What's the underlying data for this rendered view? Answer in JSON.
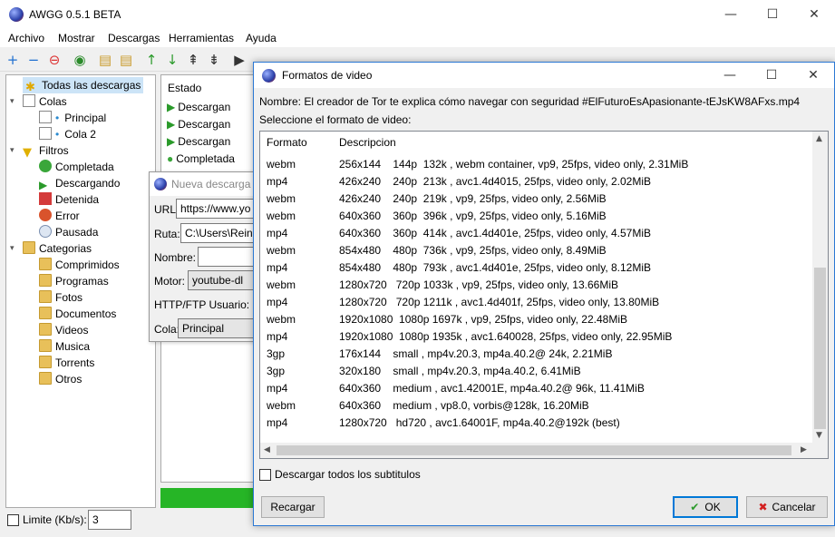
{
  "main_window": {
    "title": "AWGG 0.5.1 BETA",
    "menu": [
      "Archivo",
      "Mostrar",
      "Descargas",
      "Herramientas",
      "Ayuda"
    ]
  },
  "sidebar": {
    "all": "Todas las descargas",
    "colas": "Colas",
    "principal": "Principal",
    "cola2": "Cola 2",
    "filtros": "Filtros",
    "completada": "Completada",
    "descargando": "Descargando",
    "detenida": "Detenida",
    "error": "Error",
    "pausada": "Pausada",
    "categorias": "Categorias",
    "comprimidos": "Comprimidos",
    "programas": "Programas",
    "fotos": "Fotos",
    "documentos": "Documentos",
    "videos": "Videos",
    "musica": "Musica",
    "torrents": "Torrents",
    "otros": "Otros"
  },
  "download_list": {
    "header": "Estado",
    "rows": [
      "Descargan",
      "Descargan",
      "Descargan",
      "Completada"
    ]
  },
  "limit": {
    "label": "Limite (Kb/s):",
    "value": "3"
  },
  "nueva_descarga": {
    "title": "Nueva descarga",
    "url_label": "URL:",
    "url_value": "https://www.yo",
    "ruta_label": "Ruta:",
    "ruta_value": "C:\\Users\\Reini",
    "nombre_label": "Nombre:",
    "motor_label": "Motor:",
    "motor_value": "youtube-dl",
    "http_label": "HTTP/FTP Usuario:",
    "cola_label": "Cola:",
    "cola_value": "Principal"
  },
  "formatos": {
    "title": "Formatos de video",
    "name_line": "Nombre:  El creador de Tor te explica cómo navegar con seguridad #ElFuturoEsApasionante-tEJsKW8AFxs.mp4",
    "select_label": "Seleccione el formato de video:",
    "col_formato": "Formato",
    "col_descripcion": "Descripcion",
    "rows": [
      {
        "f": "webm",
        "d": "256x144    144p  132k , webm container, vp9, 25fps, video only, 2.31MiB"
      },
      {
        "f": "mp4",
        "d": "426x240    240p  213k , avc1.4d4015, 25fps, video only, 2.02MiB"
      },
      {
        "f": "webm",
        "d": "426x240    240p  219k , vp9, 25fps, video only, 2.56MiB"
      },
      {
        "f": "webm",
        "d": "640x360    360p  396k , vp9, 25fps, video only, 5.16MiB"
      },
      {
        "f": "mp4",
        "d": "640x360    360p  414k , avc1.4d401e, 25fps, video only, 4.57MiB"
      },
      {
        "f": "webm",
        "d": "854x480    480p  736k , vp9, 25fps, video only, 8.49MiB"
      },
      {
        "f": "mp4",
        "d": "854x480    480p  793k , avc1.4d401e, 25fps, video only, 8.12MiB"
      },
      {
        "f": "webm",
        "d": "1280x720   720p 1033k , vp9, 25fps, video only, 13.66MiB"
      },
      {
        "f": "mp4",
        "d": "1280x720   720p 1211k , avc1.4d401f, 25fps, video only, 13.80MiB"
      },
      {
        "f": "webm",
        "d": "1920x1080  1080p 1697k , vp9, 25fps, video only, 22.48MiB"
      },
      {
        "f": "mp4",
        "d": "1920x1080  1080p 1935k , avc1.640028, 25fps, video only, 22.95MiB"
      },
      {
        "f": "3gp",
        "d": "176x144    small , mp4v.20.3, mp4a.40.2@ 24k, 2.21MiB"
      },
      {
        "f": "3gp",
        "d": "320x180    small , mp4v.20.3, mp4a.40.2, 6.41MiB"
      },
      {
        "f": "mp4",
        "d": "640x360    medium , avc1.42001E, mp4a.40.2@ 96k, 11.41MiB"
      },
      {
        "f": "webm",
        "d": "640x360    medium , vp8.0, vorbis@128k, 16.20MiB"
      },
      {
        "f": "mp4",
        "d": "1280x720   hd720 , avc1.64001F, mp4a.40.2@192k (best)"
      }
    ],
    "subs_label": "Descargar todos los subtitulos",
    "recargar": "Recargar",
    "ok": "OK",
    "cancelar": "Cancelar"
  }
}
